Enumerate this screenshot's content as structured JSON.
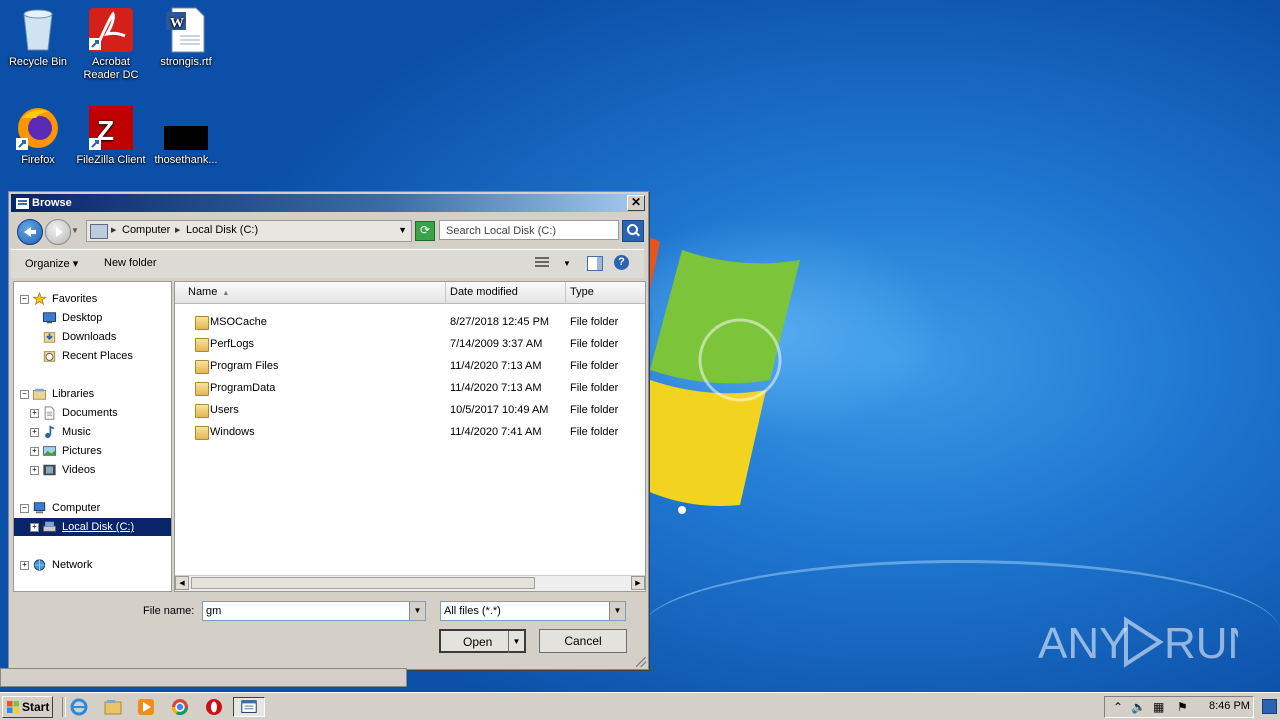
{
  "desktop": {
    "icons": [
      {
        "label": "Recycle Bin"
      },
      {
        "label": "Acrobat Reader DC"
      },
      {
        "label": "strongis.rtf"
      },
      {
        "label": "Firefox"
      },
      {
        "label": "FileZilla Client"
      },
      {
        "label": "thosethank..."
      }
    ],
    "watermark": "ANY RUN"
  },
  "dialog": {
    "title": "Browse",
    "close_label": "✕",
    "address": {
      "crumbs": [
        "Computer",
        "Local Disk (C:)"
      ]
    },
    "search_placeholder": "Search Local Disk (C:)",
    "toolbar": {
      "organize": "Organize",
      "new_folder": "New folder",
      "help": "?"
    },
    "tree": [
      {
        "label": "Favorites",
        "icon": "star-icon",
        "level": 0,
        "exp": "−"
      },
      {
        "label": "Desktop",
        "icon": "desktop-icon",
        "level": 1
      },
      {
        "label": "Downloads",
        "icon": "downloads-icon",
        "level": 1
      },
      {
        "label": "Recent Places",
        "icon": "recent-places-icon",
        "level": 1
      },
      {
        "label": "Libraries",
        "icon": "libraries-icon",
        "level": 0,
        "exp": "−"
      },
      {
        "label": "Documents",
        "icon": "documents-icon",
        "level": 1,
        "exp": "+"
      },
      {
        "label": "Music",
        "icon": "music-icon",
        "level": 1,
        "exp": "+"
      },
      {
        "label": "Pictures",
        "icon": "pictures-icon",
        "level": 1,
        "exp": "+"
      },
      {
        "label": "Videos",
        "icon": "videos-icon",
        "level": 1,
        "exp": "+"
      },
      {
        "label": "Computer",
        "icon": "computer-icon",
        "level": 0,
        "exp": "−"
      },
      {
        "label": "Local Disk (C:)",
        "icon": "drive-icon",
        "level": 1,
        "exp": "+",
        "selected": true
      },
      {
        "label": "Network",
        "icon": "network-icon",
        "level": 0,
        "exp": "+"
      }
    ],
    "columns": {
      "name": "Name",
      "date": "Date modified",
      "type": "Type"
    },
    "files": [
      {
        "name": "MSOCache",
        "date": "8/27/2018 12:45 PM",
        "type": "File folder",
        "locked": true
      },
      {
        "name": "PerfLogs",
        "date": "7/14/2009 3:37 AM",
        "type": "File folder"
      },
      {
        "name": "Program Files",
        "date": "11/4/2020 7:13 AM",
        "type": "File folder"
      },
      {
        "name": "ProgramData",
        "date": "11/4/2020 7:13 AM",
        "type": "File folder"
      },
      {
        "name": "Users",
        "date": "10/5/2017 10:49 AM",
        "type": "File folder"
      },
      {
        "name": "Windows",
        "date": "11/4/2020 7:41 AM",
        "type": "File folder"
      }
    ],
    "file_name_label": "File name:",
    "file_name_value": "gm",
    "file_type_value": "All files (*.*)",
    "open_label": "Open",
    "cancel_label": "Cancel"
  },
  "taskbar": {
    "start_label": "Start",
    "apps": [
      "internet-explorer-icon",
      "explorer-icon",
      "media-player-icon",
      "chrome-icon",
      "opera-icon",
      "browse-dialog-icon"
    ],
    "clock": "8:46 PM"
  },
  "colors": {
    "selection": "#0a246a",
    "titlebar_start": "#0a246a",
    "desktop": "#1f75c8"
  }
}
